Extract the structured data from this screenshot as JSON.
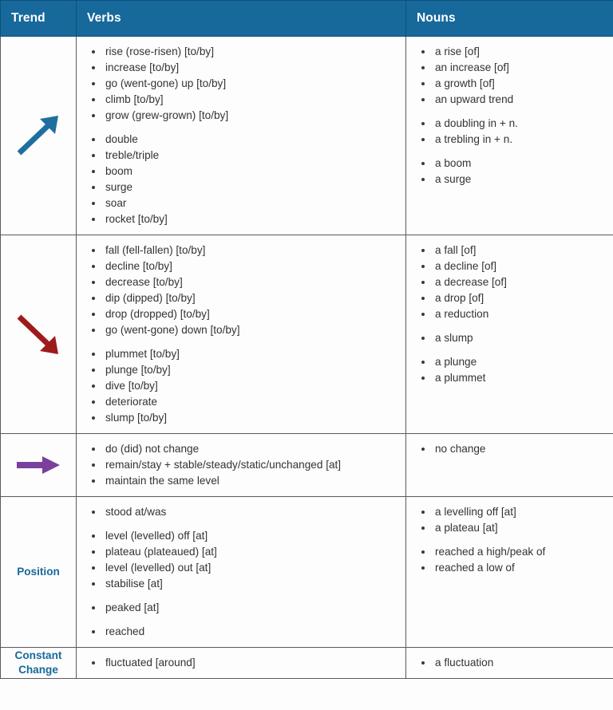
{
  "table": {
    "headers": {
      "trend": "Trend",
      "verbs": "Verbs",
      "nouns": "Nouns"
    },
    "rows": [
      {
        "id": "increase",
        "trend_icon": "arrow-up-right-icon",
        "trend_color": "#1f6f9e",
        "trend_label": "",
        "verbs": [
          {
            "text": "rise (rose-risen) [to/by]",
            "gap": false
          },
          {
            "text": "increase [to/by]",
            "gap": false
          },
          {
            "text": "go (went-gone) up [to/by]",
            "gap": false
          },
          {
            "text": "climb [to/by]",
            "gap": false
          },
          {
            "text": "grow (grew-grown) [to/by]",
            "gap": false
          },
          {
            "text": "double",
            "gap": true
          },
          {
            "text": "treble/triple",
            "gap": false
          },
          {
            "text": "boom",
            "gap": false
          },
          {
            "text": "surge",
            "gap": false
          },
          {
            "text": "soar",
            "gap": false
          },
          {
            "text": "rocket [to/by]",
            "gap": false
          }
        ],
        "nouns": [
          {
            "text": "a rise [of]",
            "gap": false
          },
          {
            "text": "an increase [of]",
            "gap": false
          },
          {
            "text": "a growth [of]",
            "gap": false
          },
          {
            "text": "an upward trend",
            "gap": false
          },
          {
            "text": "a doubling in + n.",
            "gap": true
          },
          {
            "text": "a trebling in + n.",
            "gap": false
          },
          {
            "text": "a boom",
            "gap": true
          },
          {
            "text": "a surge",
            "gap": false
          }
        ]
      },
      {
        "id": "decrease",
        "trend_icon": "arrow-down-right-icon",
        "trend_color": "#9e1b1b",
        "trend_label": "",
        "verbs": [
          {
            "text": "fall (fell-fallen) [to/by]",
            "gap": false
          },
          {
            "text": "decline [to/by]",
            "gap": false
          },
          {
            "text": "decrease [to/by]",
            "gap": false
          },
          {
            "text": "dip (dipped) [to/by]",
            "gap": false
          },
          {
            "text": "drop (dropped) [to/by]",
            "gap": false
          },
          {
            "text": "go (went-gone) down [to/by]",
            "gap": false
          },
          {
            "text": "plummet [to/by]",
            "gap": true
          },
          {
            "text": "plunge [to/by]",
            "gap": false
          },
          {
            "text": "dive [to/by]",
            "gap": false
          },
          {
            "text": "deteriorate",
            "gap": false
          },
          {
            "text": "slump [to/by]",
            "gap": false
          }
        ],
        "nouns": [
          {
            "text": "a fall [of]",
            "gap": false
          },
          {
            "text": "a decline [of]",
            "gap": false
          },
          {
            "text": "a decrease [of]",
            "gap": false
          },
          {
            "text": "a drop [of]",
            "gap": false
          },
          {
            "text": "a reduction",
            "gap": false
          },
          {
            "text": "a slump",
            "gap": true
          },
          {
            "text": "a plunge",
            "gap": true
          },
          {
            "text": "a plummet",
            "gap": false
          }
        ]
      },
      {
        "id": "no-change",
        "trend_icon": "arrow-right-icon",
        "trend_color": "#7b3f9e",
        "trend_label": "",
        "verbs": [
          {
            "text": "do (did) not change",
            "gap": false
          },
          {
            "text": "remain/stay + stable/steady/static/unchanged [at]",
            "gap": false
          },
          {
            "text": "maintain the same level",
            "gap": false
          }
        ],
        "nouns": [
          {
            "text": "no change",
            "gap": false
          }
        ]
      },
      {
        "id": "position",
        "trend_icon": "",
        "trend_color": "",
        "trend_label": "Position",
        "verbs": [
          {
            "text": "stood at/was",
            "gap": false
          },
          {
            "text": "level (levelled) off [at]",
            "gap": true
          },
          {
            "text": "plateau (plateaued) [at]",
            "gap": false
          },
          {
            "text": "level (levelled) out [at]",
            "gap": false
          },
          {
            "text": "stabilise [at]",
            "gap": false
          },
          {
            "text": "peaked [at]",
            "gap": true
          },
          {
            "text": "reached",
            "gap": true
          }
        ],
        "nouns": [
          {
            "text": "a levelling off [at]",
            "gap": false
          },
          {
            "text": "a plateau [at]",
            "gap": false
          },
          {
            "text": "reached a high/peak of",
            "gap": true
          },
          {
            "text": "reached a low of",
            "gap": false
          }
        ]
      },
      {
        "id": "constant-change",
        "trend_icon": "",
        "trend_color": "",
        "trend_label": "Constant Change",
        "verbs": [
          {
            "text": "fluctuated [around]",
            "gap": false
          }
        ],
        "nouns": [
          {
            "text": "a fluctuation",
            "gap": false
          }
        ]
      }
    ]
  },
  "colors": {
    "header_blue": "#17699c",
    "label_blue": "#17699c",
    "arrow_up": "#1f6f9e",
    "arrow_down": "#9e1b1b",
    "arrow_flat": "#7b3f9e",
    "border": "#5a5a5a"
  }
}
